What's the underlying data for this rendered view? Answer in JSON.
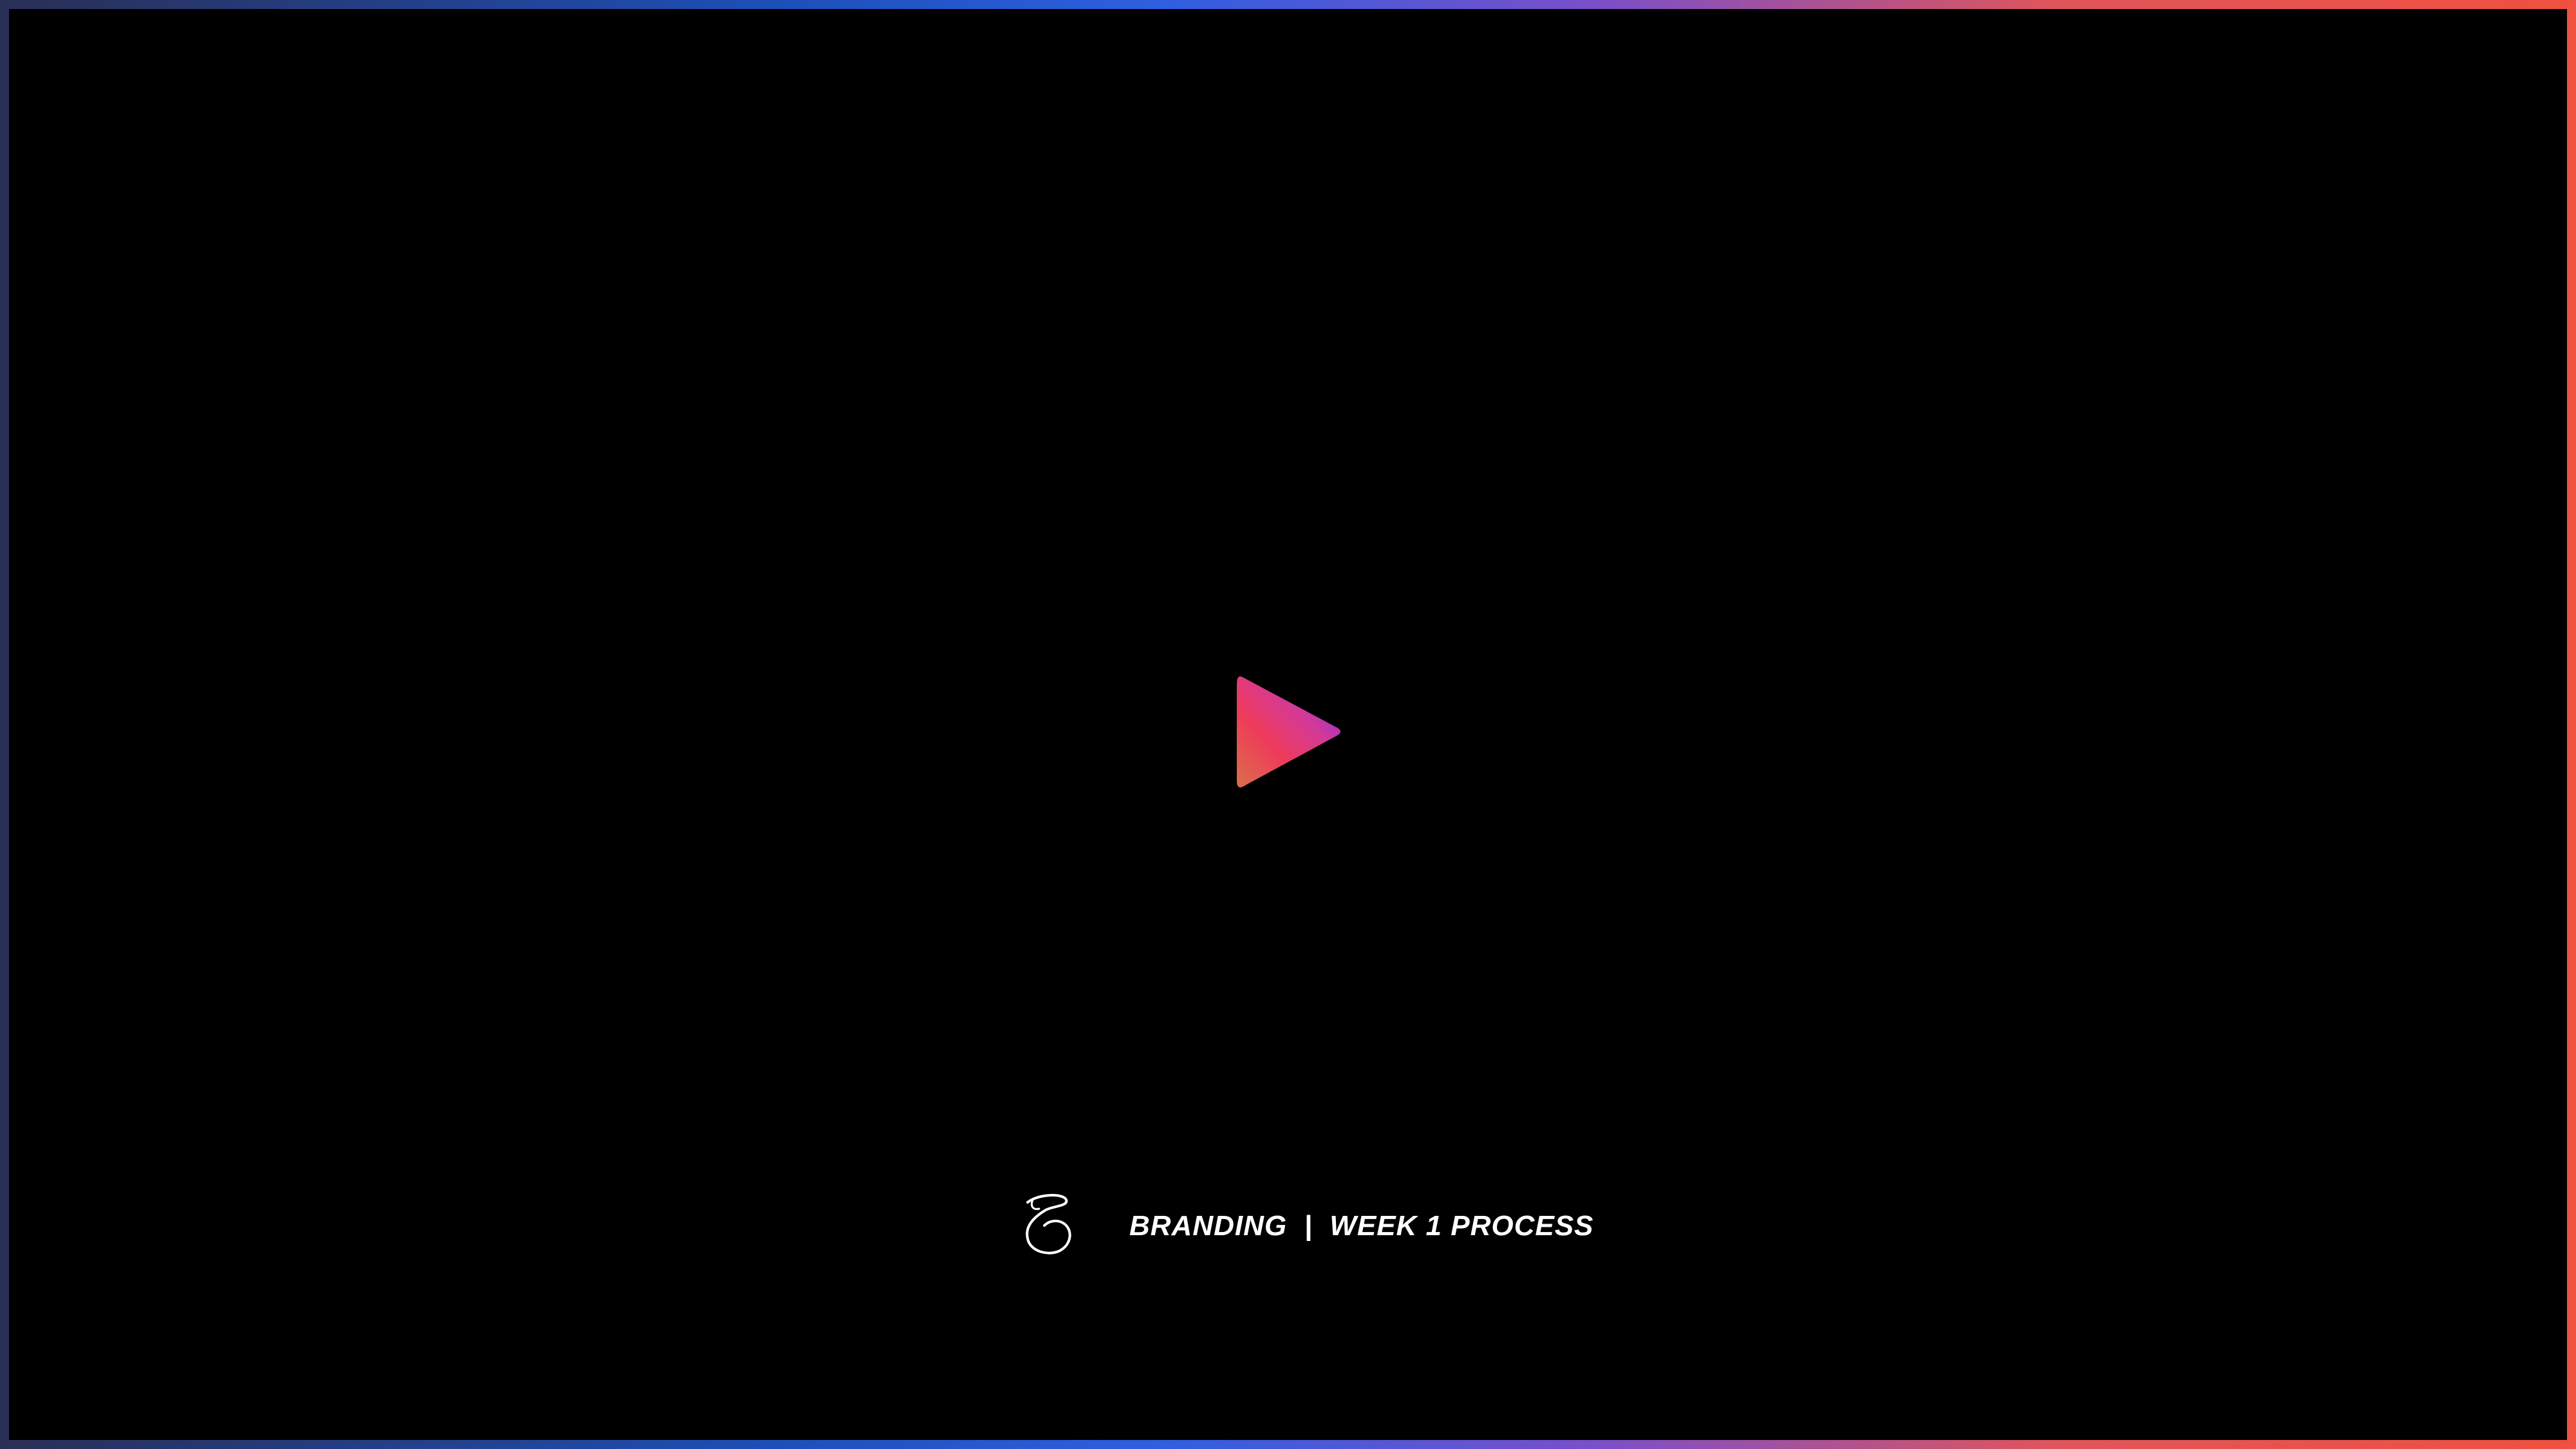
{
  "player": {
    "play_icon": "play-icon",
    "play_gradient": [
      "#ef3b5a",
      "#e03a8e",
      "#7b2ff0"
    ]
  },
  "footer": {
    "logo": "script-s-logo",
    "caption": "BRANDING  |  WEEK 1 PROCESS"
  },
  "frame": {
    "border_colors": [
      "#2a2f55",
      "#2f5fe0",
      "#e0555a",
      "#ef5040",
      "#e52a92"
    ]
  }
}
